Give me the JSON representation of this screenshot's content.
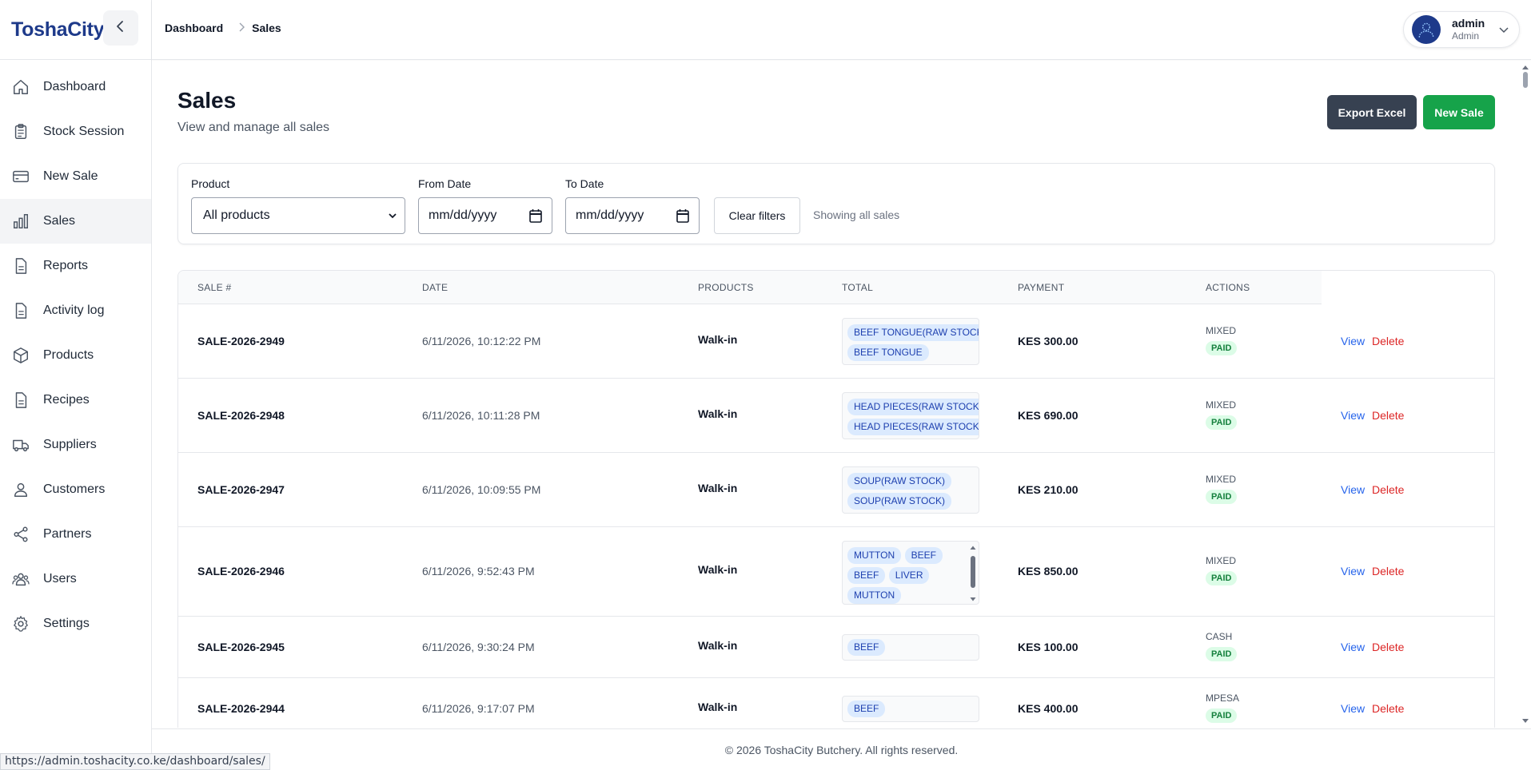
{
  "brand": "ToshaCity",
  "sidebar": {
    "items": [
      {
        "label": "Dashboard",
        "icon": "home-icon"
      },
      {
        "label": "Stock Session",
        "icon": "clipboard-icon"
      },
      {
        "label": "New Sale",
        "icon": "credit-card-icon"
      },
      {
        "label": "Sales",
        "icon": "bar-chart-icon",
        "active": true
      },
      {
        "label": "Reports",
        "icon": "document-icon"
      },
      {
        "label": "Activity log",
        "icon": "document-icon"
      },
      {
        "label": "Products",
        "icon": "cube-icon"
      },
      {
        "label": "Recipes",
        "icon": "document-icon"
      },
      {
        "label": "Suppliers",
        "icon": "truck-icon"
      },
      {
        "label": "Customers",
        "icon": "user-icon"
      },
      {
        "label": "Partners",
        "icon": "share-icon"
      },
      {
        "label": "Users",
        "icon": "users-icon"
      },
      {
        "label": "Settings",
        "icon": "gear-icon"
      }
    ]
  },
  "header": {
    "breadcrumb": [
      "Dashboard",
      "Sales"
    ],
    "user_name": "admin",
    "user_role": "Admin"
  },
  "page": {
    "title": "Sales",
    "subtitle": "View and manage all sales",
    "export_label": "Export Excel",
    "new_label": "New Sale"
  },
  "filters": {
    "product_label": "Product",
    "product_value": "All products",
    "from_label": "From Date",
    "from_value": "mm/dd/yyyy",
    "to_label": "To Date",
    "to_value": "mm/dd/yyyy",
    "clear_label": "Clear filters",
    "status": "Showing all sales"
  },
  "table": {
    "columns": [
      "SALE #",
      "DATE",
      "PRODUCTS",
      "TOTAL",
      "PAYMENT",
      "ACTIONS"
    ],
    "customer_label": "Walk-in",
    "view_label": "View",
    "delete_label": "Delete",
    "rows": [
      {
        "sale": "SALE-2026-2949",
        "date": "6/11/2026, 10:12:22 PM",
        "customer": "Walk-in",
        "products": [
          "BEEF TONGUE(RAW STOCK)",
          "BEEF TONGUE"
        ],
        "total": "KES 300.00",
        "method": "MIXED",
        "status": "PAID"
      },
      {
        "sale": "SALE-2026-2948",
        "date": "6/11/2026, 10:11:28 PM",
        "customer": "Walk-in",
        "products": [
          "HEAD PIECES(RAW STOCK)",
          "HEAD PIECES(RAW STOCK)"
        ],
        "total": "KES 690.00",
        "method": "MIXED",
        "status": "PAID"
      },
      {
        "sale": "SALE-2026-2947",
        "date": "6/11/2026, 10:09:55 PM",
        "customer": "Walk-in",
        "products": [
          "SOUP(RAW STOCK)",
          "SOUP(RAW STOCK)"
        ],
        "total": "KES 210.00",
        "method": "MIXED",
        "status": "PAID"
      },
      {
        "sale": "SALE-2026-2946",
        "date": "6/11/2026, 9:52:43 PM",
        "customer": "Walk-in",
        "products": [
          "MUTTON",
          "BEEF",
          "BEEF",
          "LIVER",
          "MUTTON"
        ],
        "total": "KES 850.00",
        "method": "MIXED",
        "status": "PAID"
      },
      {
        "sale": "SALE-2026-2945",
        "date": "6/11/2026, 9:30:24 PM",
        "customer": "Walk-in",
        "products": [
          "BEEF"
        ],
        "total": "KES 100.00",
        "method": "CASH",
        "status": "PAID"
      },
      {
        "sale": "SALE-2026-2944",
        "date": "6/11/2026, 9:17:07 PM",
        "customer": "Walk-in",
        "products": [
          "BEEF"
        ],
        "total": "KES 400.00",
        "method": "MPESA",
        "status": "PAID"
      }
    ]
  },
  "footer": "© 2026 ToshaCity Butchery. All rights reserved.",
  "status_url": "https://admin.toshacity.co.ke/dashboard/sales/"
}
